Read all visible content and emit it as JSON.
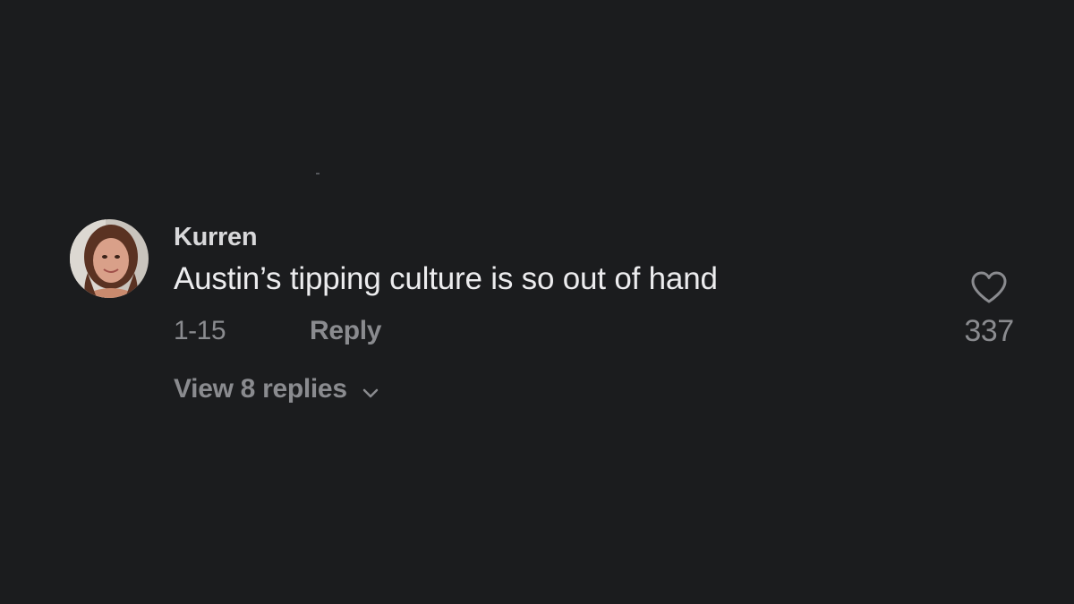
{
  "comment": {
    "username": "Kurren",
    "text": "Austin’s tipping culture is so out of hand",
    "date": "1-15",
    "reply_label": "Reply",
    "view_replies_label": "View 8 replies",
    "like_count": "337",
    "avatar_icon": "user-avatar-photo",
    "like_icon": "heart-outline-icon",
    "expand_icon": "chevron-down-icon"
  },
  "colors": {
    "background": "#1b1c1e",
    "primary_text": "#ececee",
    "secondary_text": "#8a8b8f"
  }
}
